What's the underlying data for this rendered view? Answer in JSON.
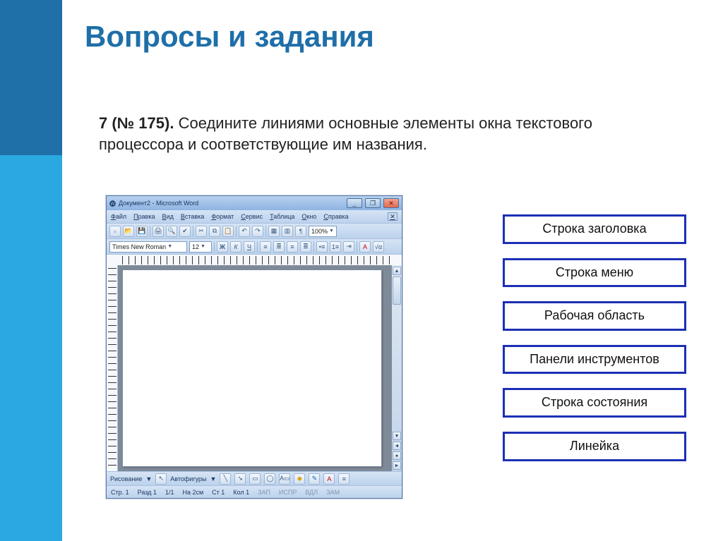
{
  "slide": {
    "title": "Вопросы и задания",
    "prompt_bold": "7 (№ 175).",
    "prompt_rest": " Соедините линиями основные элементы окна текстового процессора и соответствующие им названия."
  },
  "word": {
    "title": "Документ2 - Microsoft Word",
    "menus": [
      "Файл",
      "Правка",
      "Вид",
      "Вставка",
      "Формат",
      "Сервис",
      "Таблица",
      "Окно",
      "Справка"
    ],
    "font_name": "Times New Roman",
    "font_size": "12",
    "zoom": "100%",
    "bold": "Ж",
    "italic": "К",
    "underline": "Ч",
    "draw_label": "Рисование",
    "autoshapes": "Автофигуры",
    "status": {
      "page": "Стр. 1",
      "sect": "Разд 1",
      "pages": "1/1",
      "at": "На 2см",
      "line": "Ст 1",
      "col": "Кол 1",
      "rec": "ЗАП",
      "fix": "ИСПР",
      "ext": "ВДЛ",
      "ovr": "ЗАМ"
    }
  },
  "answers": [
    "Строка заголовка",
    "Строка меню",
    "Рабочая область",
    "Панели инструментов",
    "Строка состояния",
    "Линейка"
  ]
}
